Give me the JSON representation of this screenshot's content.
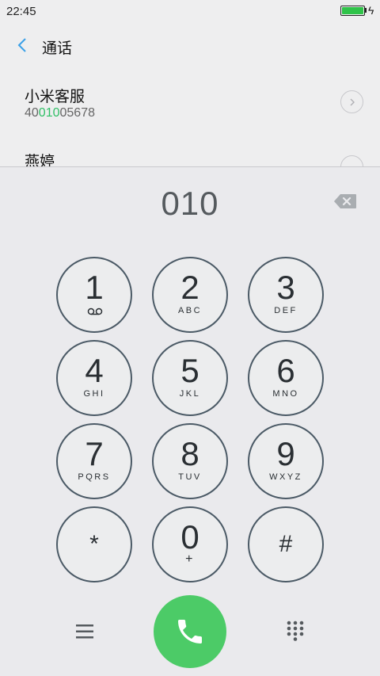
{
  "status": {
    "time": "22:45",
    "battery_level": 1.0
  },
  "header": {
    "title": "通话"
  },
  "contacts": [
    {
      "name": "小米客服",
      "number_prefix": "40",
      "number_match": "010",
      "number_suffix": "05678"
    },
    {
      "name": "燕婷"
    }
  ],
  "dialer": {
    "display": "010",
    "keys": [
      {
        "digit": "1",
        "letters": ""
      },
      {
        "digit": "2",
        "letters": "ABC"
      },
      {
        "digit": "3",
        "letters": "DEF"
      },
      {
        "digit": "4",
        "letters": "GHI"
      },
      {
        "digit": "5",
        "letters": "JKL"
      },
      {
        "digit": "6",
        "letters": "MNO"
      },
      {
        "digit": "7",
        "letters": "PQRS"
      },
      {
        "digit": "8",
        "letters": "TUV"
      },
      {
        "digit": "9",
        "letters": "WXYZ"
      },
      {
        "digit": "*",
        "letters": ""
      },
      {
        "digit": "0",
        "letters": "+"
      },
      {
        "digit": "#",
        "letters": ""
      }
    ]
  },
  "colors": {
    "accent": "#4ccb67",
    "match": "#2fbf66",
    "back": "#3aa0e8",
    "battery": "#2fc349"
  }
}
